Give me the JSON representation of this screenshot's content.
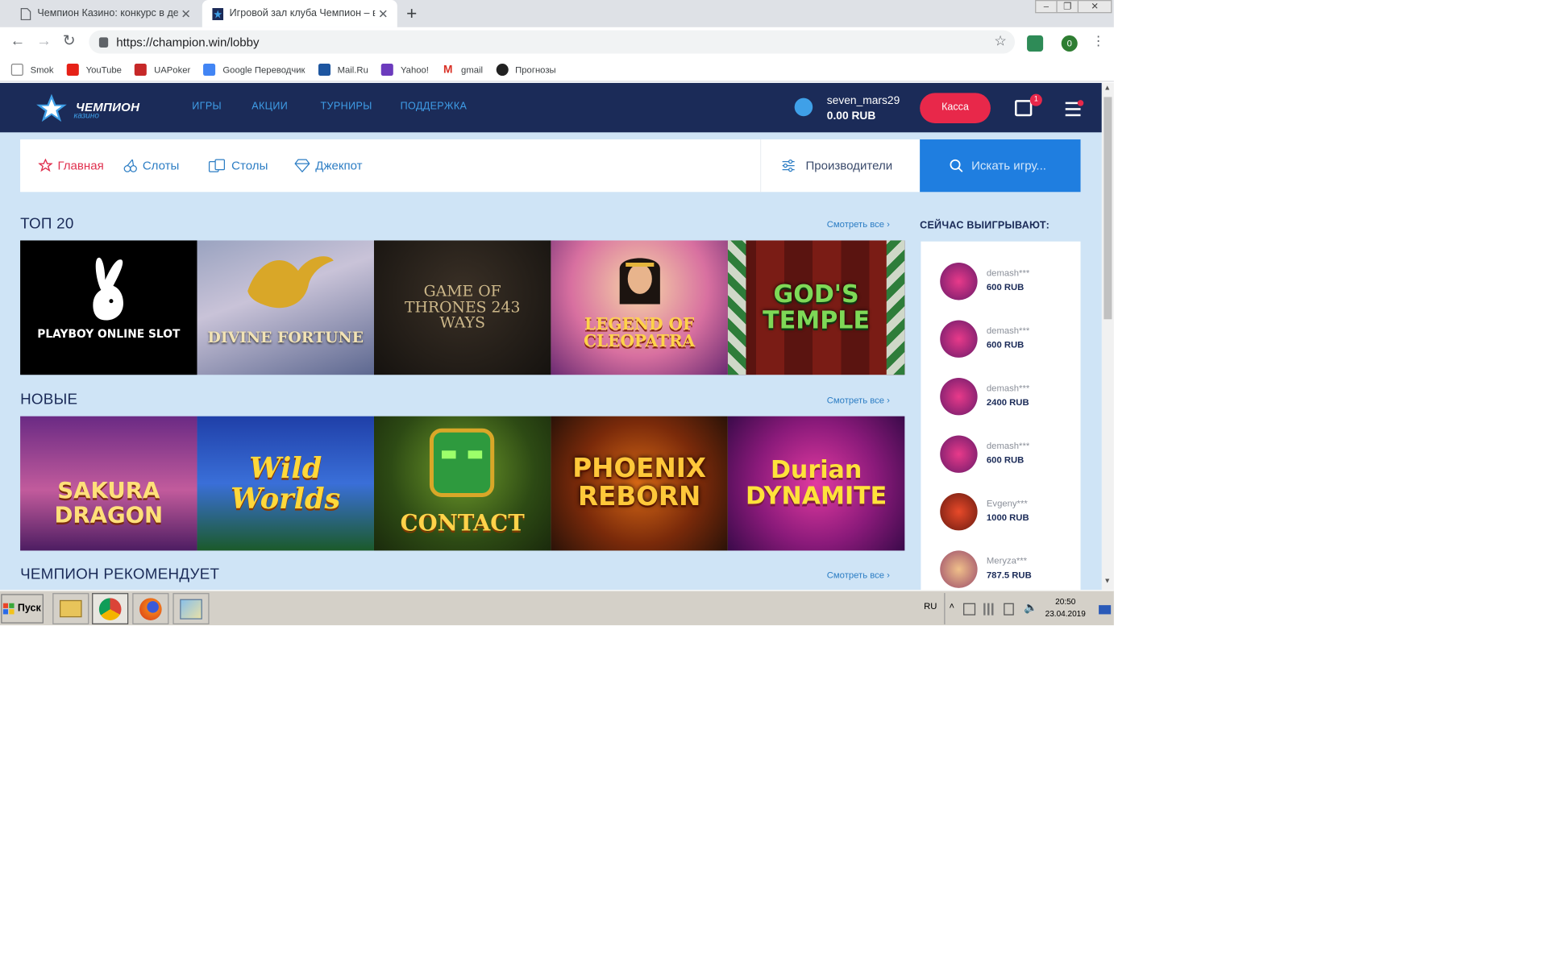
{
  "browser": {
    "tabs": [
      {
        "title": "Чемпион Казино: конкурс в демо-",
        "active": false
      },
      {
        "title": "Игровой зал клуба Чемпион – все",
        "active": true
      }
    ],
    "url": "https://champion.win/lobby",
    "bookmarks": [
      "Smok",
      "YouTube",
      "UAPoker",
      "Google Переводчик",
      "Mail.Ru",
      "Yahoo!",
      "gmail",
      "Прогнозы"
    ],
    "extension_badge": "0"
  },
  "site": {
    "logo_title": "ЧЕМПИОН",
    "logo_sub": "казино",
    "menu": [
      "ИГРЫ",
      "АКЦИИ",
      "ТУРНИРЫ",
      "ПОДДЕРЖКА"
    ],
    "user": {
      "name": "seven_mars29",
      "balance": "0.00 RUB"
    },
    "cashier_label": "Касса",
    "gift_count": "1",
    "subnav": [
      "Главная",
      "Слоты",
      "Столы",
      "Джекпот"
    ],
    "providers_label": "Производители",
    "search_placeholder": "Искать игру...",
    "see_all": "Смотреть все",
    "sections": [
      {
        "title": "ТОП 20",
        "games": [
          "PLAYBOY ONLINE SLOT",
          "DIVINE FORTUNE",
          "GAME OF THRONES 243 WAYS",
          "LEGEND OF CLEOPATRA",
          "GOD'S TEMPLE"
        ]
      },
      {
        "title": "НОВЫЕ",
        "games": [
          "SAKURA DRAGON",
          "Wild Worlds",
          "CONTACT",
          "PHOENIX REBORN",
          "Durian DYNAMITE"
        ]
      },
      {
        "title": "ЧЕМПИОН РЕКОМЕНДУЕТ",
        "games": []
      }
    ],
    "winners_title": "СЕЙЧАС ВЫИГРЫВАЮТ:",
    "winners": [
      {
        "name": "demash***",
        "amount": "600 RUB"
      },
      {
        "name": "demash***",
        "amount": "600 RUB"
      },
      {
        "name": "demash***",
        "amount": "2400 RUB"
      },
      {
        "name": "demash***",
        "amount": "600 RUB"
      },
      {
        "name": "Evgeny***",
        "amount": "1000 RUB"
      },
      {
        "name": "Meryza***",
        "amount": "787.5 RUB"
      }
    ]
  },
  "taskbar": {
    "start_label": "Пуск",
    "lang": "RU",
    "time": "20:50",
    "date": "23.04.2019"
  },
  "colors": {
    "nav_bg": "#1b2b58",
    "page_bg": "#cfe4f6",
    "accent_red": "#e8284a",
    "accent_blue": "#1f7ee0"
  }
}
